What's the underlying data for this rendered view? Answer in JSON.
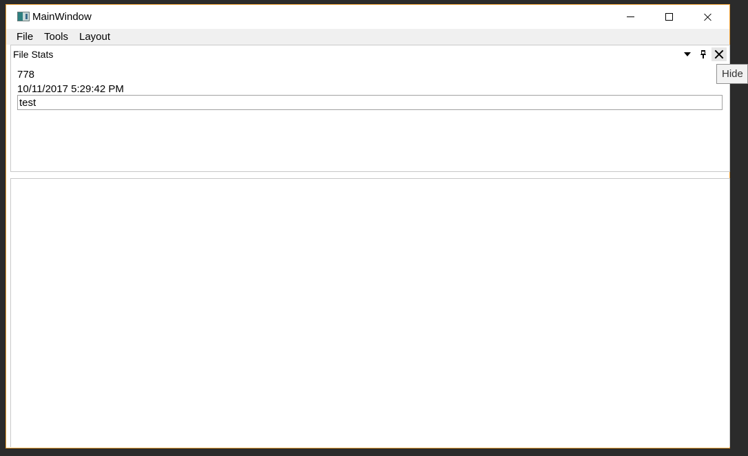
{
  "window": {
    "title": "MainWindow",
    "accent_border_color": "#f0a030",
    "controls": {
      "minimize_icon": "minimize-icon",
      "maximize_icon": "maximize-icon",
      "close_icon": "close-icon"
    }
  },
  "menu": {
    "items": [
      {
        "label": "File"
      },
      {
        "label": "Tools"
      },
      {
        "label": "Layout"
      }
    ]
  },
  "file_stats_pane": {
    "title": "File Stats",
    "count": "778",
    "timestamp": "10/11/2017 5:29:42 PM",
    "input_value": "test",
    "buttons": {
      "dropdown_icon": "triangle-down-icon",
      "pin_icon": "pin-icon",
      "hide_icon": "close-icon"
    }
  },
  "tooltip": {
    "text": "Hide"
  }
}
